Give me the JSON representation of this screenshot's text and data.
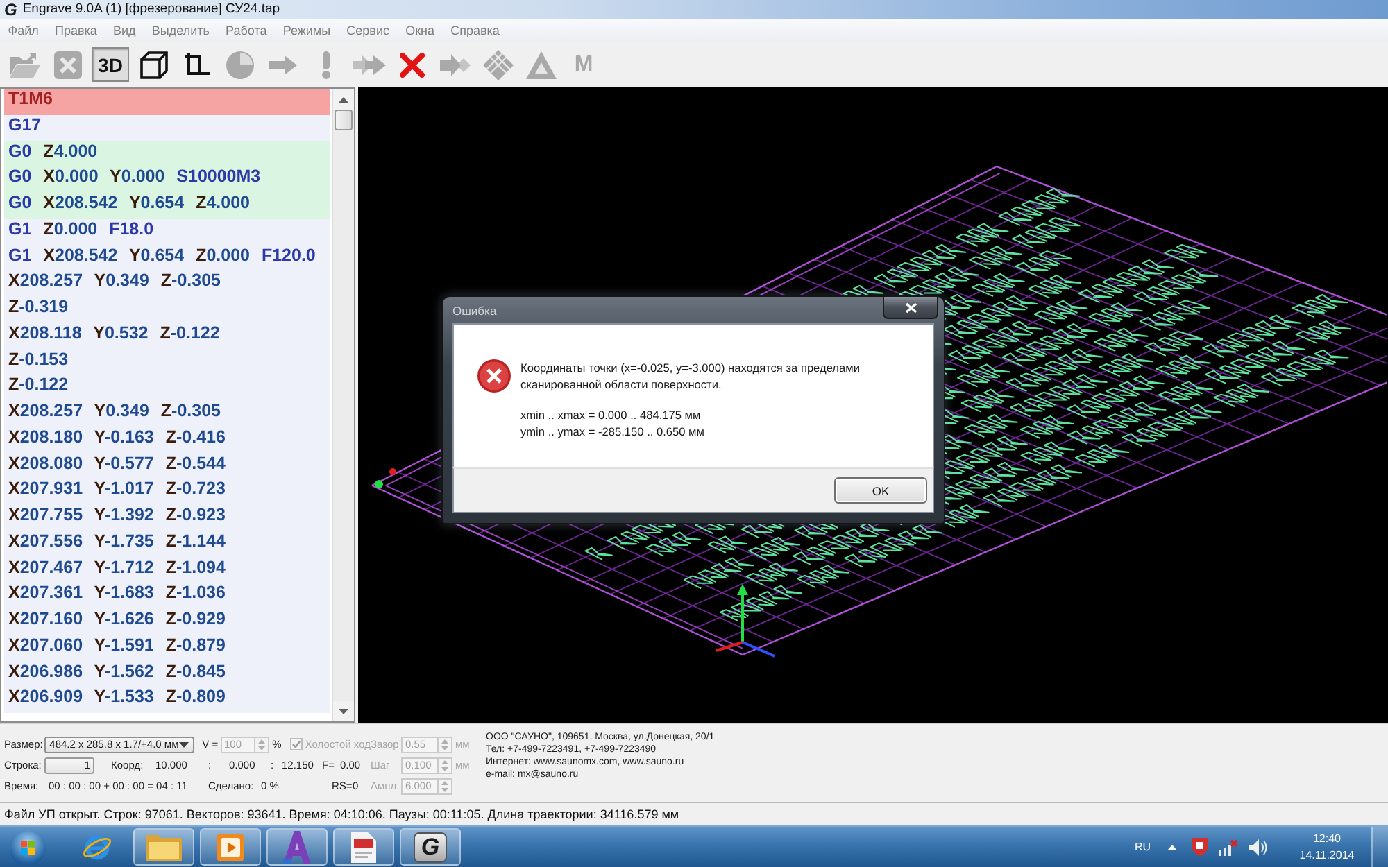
{
  "window": {
    "logo": "G",
    "title": "Engrave 9.0A (1) [фрезерование] СУ24.tap"
  },
  "menu": [
    "Файл",
    "Правка",
    "Вид",
    "Выделить",
    "Работа",
    "Режимы",
    "Сервис",
    "Окна",
    "Справка"
  ],
  "toolbar": [
    {
      "disabled": true,
      "pressed": false
    },
    {
      "disabled": true,
      "pressed": false
    },
    {
      "label": "3D",
      "disabled": false,
      "pressed": true
    },
    {
      "disabled": false,
      "pressed": false
    },
    {
      "disabled": false,
      "pressed": false
    },
    {
      "disabled": true,
      "pressed": false
    },
    {
      "disabled": true,
      "pressed": false
    },
    {
      "disabled": true,
      "pressed": false
    },
    {
      "disabled": true,
      "pressed": false
    },
    {
      "disabled": false,
      "pressed": false
    },
    {
      "disabled": true,
      "pressed": false
    },
    {
      "disabled": true,
      "pressed": false
    },
    {
      "disabled": true,
      "pressed": false
    },
    {
      "label": "M",
      "disabled": true,
      "pressed": false
    }
  ],
  "program": {
    "lines": [
      {
        "words": [
          {
            "text": "T1M6",
            "kind": "code"
          }
        ],
        "selected": true,
        "rapid": false
      },
      {
        "words": [
          {
            "text": "G17",
            "kind": "code"
          }
        ],
        "selected": false,
        "rapid": false
      },
      {
        "words": [
          {
            "text": "G0",
            "kind": "code"
          },
          {
            "text": "Z4.000",
            "kind": "axis"
          }
        ],
        "selected": false,
        "rapid": true
      },
      {
        "words": [
          {
            "text": "G0",
            "kind": "code"
          },
          {
            "text": "X0.000",
            "kind": "axis"
          },
          {
            "text": "Y0.000",
            "kind": "axis"
          },
          {
            "text": "S10000M3",
            "kind": "code"
          }
        ],
        "selected": false,
        "rapid": true
      },
      {
        "words": [
          {
            "text": "G0",
            "kind": "code"
          },
          {
            "text": "X208.542",
            "kind": "axis"
          },
          {
            "text": "Y0.654",
            "kind": "axis"
          },
          {
            "text": "Z4.000",
            "kind": "axis"
          }
        ],
        "selected": false,
        "rapid": true
      },
      {
        "words": [
          {
            "text": "G1",
            "kind": "code"
          },
          {
            "text": "Z0.000",
            "kind": "axis"
          },
          {
            "text": "F18.0",
            "kind": "code"
          }
        ],
        "selected": false,
        "rapid": false
      },
      {
        "words": [
          {
            "text": "G1",
            "kind": "code"
          },
          {
            "text": "X208.542",
            "kind": "axis"
          },
          {
            "text": "Y0.654",
            "kind": "axis"
          },
          {
            "text": "Z0.000",
            "kind": "axis"
          },
          {
            "text": "F120.0",
            "kind": "code"
          }
        ],
        "selected": false,
        "rapid": false
      },
      {
        "words": [
          {
            "text": "X208.257",
            "kind": "axis"
          },
          {
            "text": "Y0.349",
            "kind": "axis"
          },
          {
            "text": "Z-0.305",
            "kind": "axis"
          }
        ],
        "selected": false,
        "rapid": false
      },
      {
        "words": [
          {
            "text": "Z-0.319",
            "kind": "axis"
          }
        ],
        "selected": false,
        "rapid": false
      },
      {
        "words": [
          {
            "text": "X208.118",
            "kind": "axis"
          },
          {
            "text": "Y0.532",
            "kind": "axis"
          },
          {
            "text": "Z-0.122",
            "kind": "axis"
          }
        ],
        "selected": false,
        "rapid": false
      },
      {
        "words": [
          {
            "text": "Z-0.153",
            "kind": "axis"
          }
        ],
        "selected": false,
        "rapid": false
      },
      {
        "words": [
          {
            "text": "Z-0.122",
            "kind": "axis"
          }
        ],
        "selected": false,
        "rapid": false
      },
      {
        "words": [
          {
            "text": "X208.257",
            "kind": "axis"
          },
          {
            "text": "Y0.349",
            "kind": "axis"
          },
          {
            "text": "Z-0.305",
            "kind": "axis"
          }
        ],
        "selected": false,
        "rapid": false
      },
      {
        "words": [
          {
            "text": "X208.180",
            "kind": "axis"
          },
          {
            "text": "Y-0.163",
            "kind": "axis"
          },
          {
            "text": "Z-0.416",
            "kind": "axis"
          }
        ],
        "selected": false,
        "rapid": false
      },
      {
        "words": [
          {
            "text": "X208.080",
            "kind": "axis"
          },
          {
            "text": "Y-0.577",
            "kind": "axis"
          },
          {
            "text": "Z-0.544",
            "kind": "axis"
          }
        ],
        "selected": false,
        "rapid": false
      },
      {
        "words": [
          {
            "text": "X207.931",
            "kind": "axis"
          },
          {
            "text": "Y-1.017",
            "kind": "axis"
          },
          {
            "text": "Z-0.723",
            "kind": "axis"
          }
        ],
        "selected": false,
        "rapid": false
      },
      {
        "words": [
          {
            "text": "X207.755",
            "kind": "axis"
          },
          {
            "text": "Y-1.392",
            "kind": "axis"
          },
          {
            "text": "Z-0.923",
            "kind": "axis"
          }
        ],
        "selected": false,
        "rapid": false
      },
      {
        "words": [
          {
            "text": "X207.556",
            "kind": "axis"
          },
          {
            "text": "Y-1.735",
            "kind": "axis"
          },
          {
            "text": "Z-1.144",
            "kind": "axis"
          }
        ],
        "selected": false,
        "rapid": false
      },
      {
        "words": [
          {
            "text": "X207.467",
            "kind": "axis"
          },
          {
            "text": "Y-1.712",
            "kind": "axis"
          },
          {
            "text": "Z-1.094",
            "kind": "axis"
          }
        ],
        "selected": false,
        "rapid": false
      },
      {
        "words": [
          {
            "text": "X207.361",
            "kind": "axis"
          },
          {
            "text": "Y-1.683",
            "kind": "axis"
          },
          {
            "text": "Z-1.036",
            "kind": "axis"
          }
        ],
        "selected": false,
        "rapid": false
      },
      {
        "words": [
          {
            "text": "X207.160",
            "kind": "axis"
          },
          {
            "text": "Y-1.626",
            "kind": "axis"
          },
          {
            "text": "Z-0.929",
            "kind": "axis"
          }
        ],
        "selected": false,
        "rapid": false
      },
      {
        "words": [
          {
            "text": "X207.060",
            "kind": "axis"
          },
          {
            "text": "Y-1.591",
            "kind": "axis"
          },
          {
            "text": "Z-0.879",
            "kind": "axis"
          }
        ],
        "selected": false,
        "rapid": false
      },
      {
        "words": [
          {
            "text": "X206.986",
            "kind": "axis"
          },
          {
            "text": "Y-1.562",
            "kind": "axis"
          },
          {
            "text": "Z-0.845",
            "kind": "axis"
          }
        ],
        "selected": false,
        "rapid": false
      },
      {
        "words": [
          {
            "text": "X206.909",
            "kind": "axis"
          },
          {
            "text": "Y-1.533",
            "kind": "axis"
          },
          {
            "text": "Z-0.809",
            "kind": "axis"
          }
        ],
        "selected": false,
        "rapid": false
      }
    ]
  },
  "dialog": {
    "title": "Ошибка",
    "message": "Координаты точки (x=-0.025, y=-3.000) находятся за пределами сканированной области поверхности.",
    "details": [
      "xmin .. xmax = 0.000 .. 484.175 мм",
      "ymin .. ymax = -285.150 .. 0.650 мм"
    ],
    "button": "OK"
  },
  "info_panel": {
    "size": {
      "label": "Размер:",
      "value": "484.2 x 285.8 x 1.7/+4.0 мм"
    },
    "speed": {
      "label": "V =",
      "value": "100",
      "unit": "%",
      "disabled": true
    },
    "idle_move": {
      "label": "Холостой ход",
      "checked": true,
      "disabled": true
    },
    "line": {
      "label": "Строка:",
      "value": "1"
    },
    "coords": {
      "label": "Коорд:",
      "parts": [
        "10.000",
        ":",
        "0.000",
        ":",
        "12.150"
      ]
    },
    "feed": {
      "label": "F=",
      "value": "0.00"
    },
    "time": {
      "label": "Время:",
      "value": "00 : 00 : 00 + 00 : 00 = 04 : 11"
    },
    "done": {
      "label": "Сделано:",
      "value": "0 %"
    },
    "rs": {
      "label": "RS=",
      "value": "0"
    },
    "settings": [
      {
        "label": "Зазор",
        "value": "0.55",
        "unit": "мм",
        "disabled": true
      },
      {
        "label": "Шаг",
        "value": "0.100",
        "unit": "мм",
        "disabled": true
      },
      {
        "label": "Ампл.",
        "value": "6.000",
        "disabled": true
      }
    ],
    "company": [
      "ООО \"САУНО\", 109651, Москва, ул.Донецкая, 20/1",
      "Тел: +7-499-7223491, +7-499-7223490",
      "Интернет: www.saunomx.com, www.sauno.ru",
      "e-mail: mx@sauno.ru"
    ]
  },
  "status_bar": "Файл УП открыт. Строк: 97061. Векторов: 93641. Время: 04:10:06. Паузы: 00:11:05. Длина траектории: 34116.579 мм",
  "taskbar": {
    "items": [
      {
        "running": false
      },
      {
        "running": true
      },
      {
        "running": true
      },
      {
        "running": true
      },
      {
        "running": true
      },
      {
        "label": "G",
        "running": true
      }
    ],
    "language": "RU",
    "time": "12:40",
    "date": "14.11.2014"
  }
}
